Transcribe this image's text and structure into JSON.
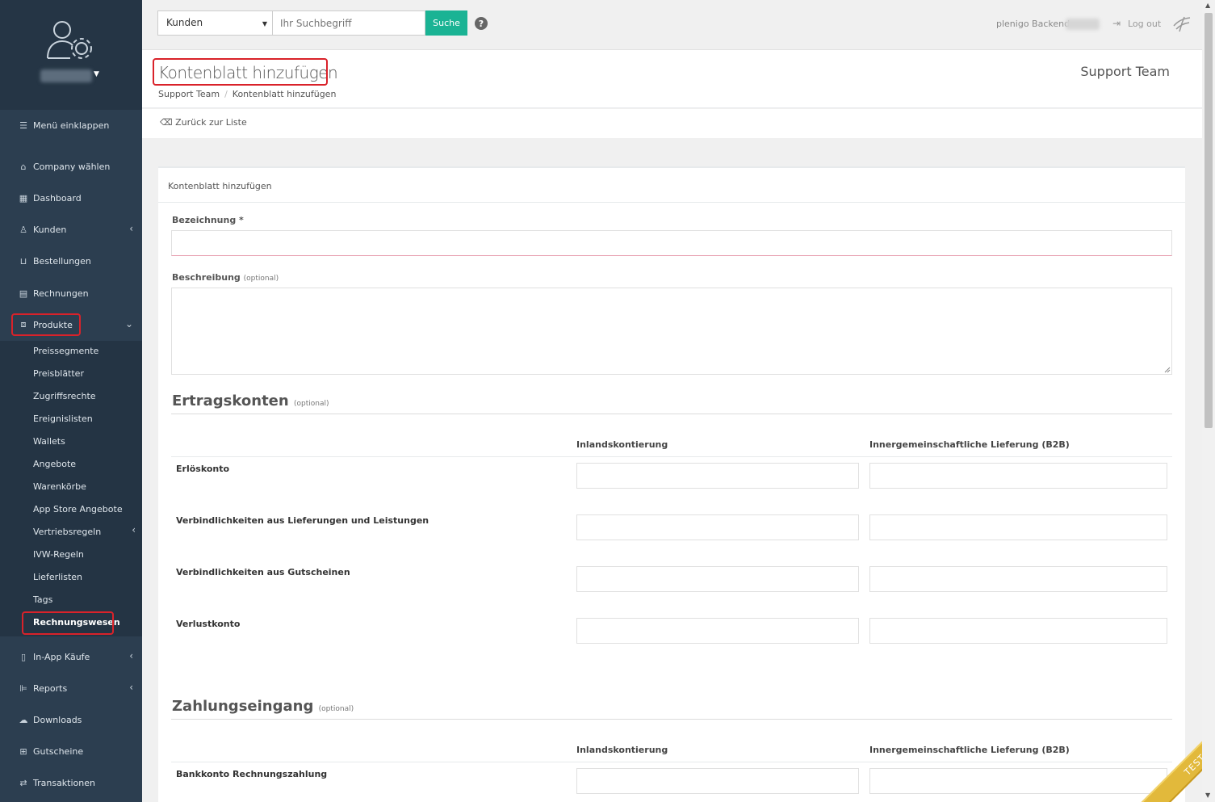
{
  "sidebar": {
    "collapse_label": "Menü einklappen",
    "items": [
      {
        "label": "Company wählen",
        "icon": "home-icon"
      },
      {
        "label": "Dashboard",
        "icon": "grid-icon"
      },
      {
        "label": "Kunden",
        "icon": "user-icon"
      },
      {
        "label": "Bestellungen",
        "icon": "basket-icon"
      },
      {
        "label": "Rechnungen",
        "icon": "document-icon"
      },
      {
        "label": "Produkte",
        "icon": "products-icon"
      },
      {
        "label": "In-App Käufe",
        "icon": "phone-icon"
      },
      {
        "label": "Reports",
        "icon": "chart-icon"
      },
      {
        "label": "Downloads",
        "icon": "cloud-download-icon"
      },
      {
        "label": "Gutscheine",
        "icon": "gift-icon"
      },
      {
        "label": "Transaktionen",
        "icon": "transfer-icon"
      }
    ],
    "sub_items": [
      "Preissegmente",
      "Preisblätter",
      "Zugriffsrechte",
      "Ereignislisten",
      "Wallets",
      "Angebote",
      "Warenkörbe",
      "App Store Angebote",
      "Vertriebsregeln",
      "IVW-Regeln",
      "Lieferlisten",
      "Tags",
      "Rechnungswesen"
    ]
  },
  "topbar": {
    "search_scope": "Kunden",
    "search_placeholder": "Ihr Suchbegriff",
    "search_button": "Suche",
    "help": "?",
    "backend_label": "plenigo Backend",
    "logout_label": "Log out"
  },
  "header": {
    "title": "Kontenblatt hinzufügen",
    "breadcrumb": [
      "Support Team",
      "Kontenblatt hinzufügen"
    ],
    "team": "Support Team",
    "back_link": "Zurück zur Liste"
  },
  "form": {
    "card_title": "Kontenblatt hinzufügen",
    "bezeichnung_label": "Bezeichnung",
    "required_marker": "*",
    "beschreibung_label": "Beschreibung",
    "optional": "(optional)",
    "section1_title": "Ertragskonten",
    "section2_title": "Zahlungseingang",
    "col_inland": "Inlandskontierung",
    "col_b2b": "Innergemeinschaftliche Lieferung (B2B)",
    "rows1": [
      "Erlöskonto",
      "Verbindlichkeiten aus Lieferungen und Leistungen",
      "Verbindlichkeiten aus Gutscheinen",
      "Verlustkonto"
    ],
    "rows2": [
      "Bankkonto Rechnungszahlung"
    ]
  },
  "ribbon": "TEST",
  "colors": {
    "sidebar": "#2c3e50",
    "accent": "#1ab394",
    "highlight": "#d9222a",
    "ribbon": "#e2b93b"
  }
}
